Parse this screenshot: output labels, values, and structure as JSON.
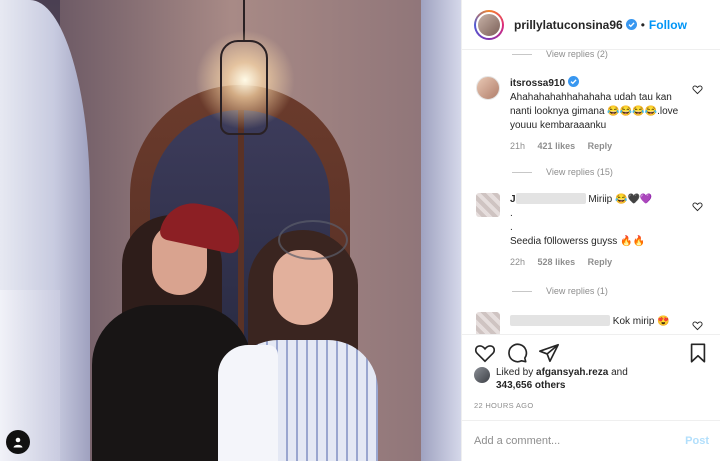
{
  "post": {
    "username": "prillylatuconsina96",
    "follow_label": "Follow",
    "dot": "•"
  },
  "comments": [
    {
      "kind": "view-replies",
      "label": "View replies (2)"
    },
    {
      "kind": "comment",
      "username": "itsrossa910",
      "text": "Ahahahahahhahahaha udah tau kan nanti looknya gimana 😂😂😂😂.love youuu kembaraaanku",
      "time": "21h",
      "likes": "421 likes",
      "reply": "Reply"
    },
    {
      "kind": "view-replies",
      "label": "View replies (15)"
    },
    {
      "kind": "comment",
      "username_prefix": "J",
      "text_line1": "Miriip 😂🖤💜",
      "text_line2": ".",
      "text_line3": ".",
      "text_line4": "Seedia f0llowerss guyss 🔥🔥",
      "time": "22h",
      "likes": "528 likes",
      "reply": "Reply"
    },
    {
      "kind": "view-replies",
      "label": "View replies (1)"
    },
    {
      "kind": "comment",
      "text": "Kok mirip 😍"
    }
  ],
  "likes": {
    "liked_by_prefix": "Liked by",
    "liked_by_user": "afgansyah.reza",
    "and": "and",
    "others": "343,656 others"
  },
  "timestamp": "22 HOURS AGO",
  "add_comment": {
    "placeholder": "Add a comment...",
    "post_label": "Post"
  },
  "colors": {
    "accent": "#0095f6",
    "post_disabled": "#b2dffc",
    "muted": "#8e8e8e"
  },
  "icons": [
    "heart-icon",
    "comment-icon",
    "share-icon",
    "bookmark-icon",
    "verified-icon",
    "user-tag-icon"
  ]
}
